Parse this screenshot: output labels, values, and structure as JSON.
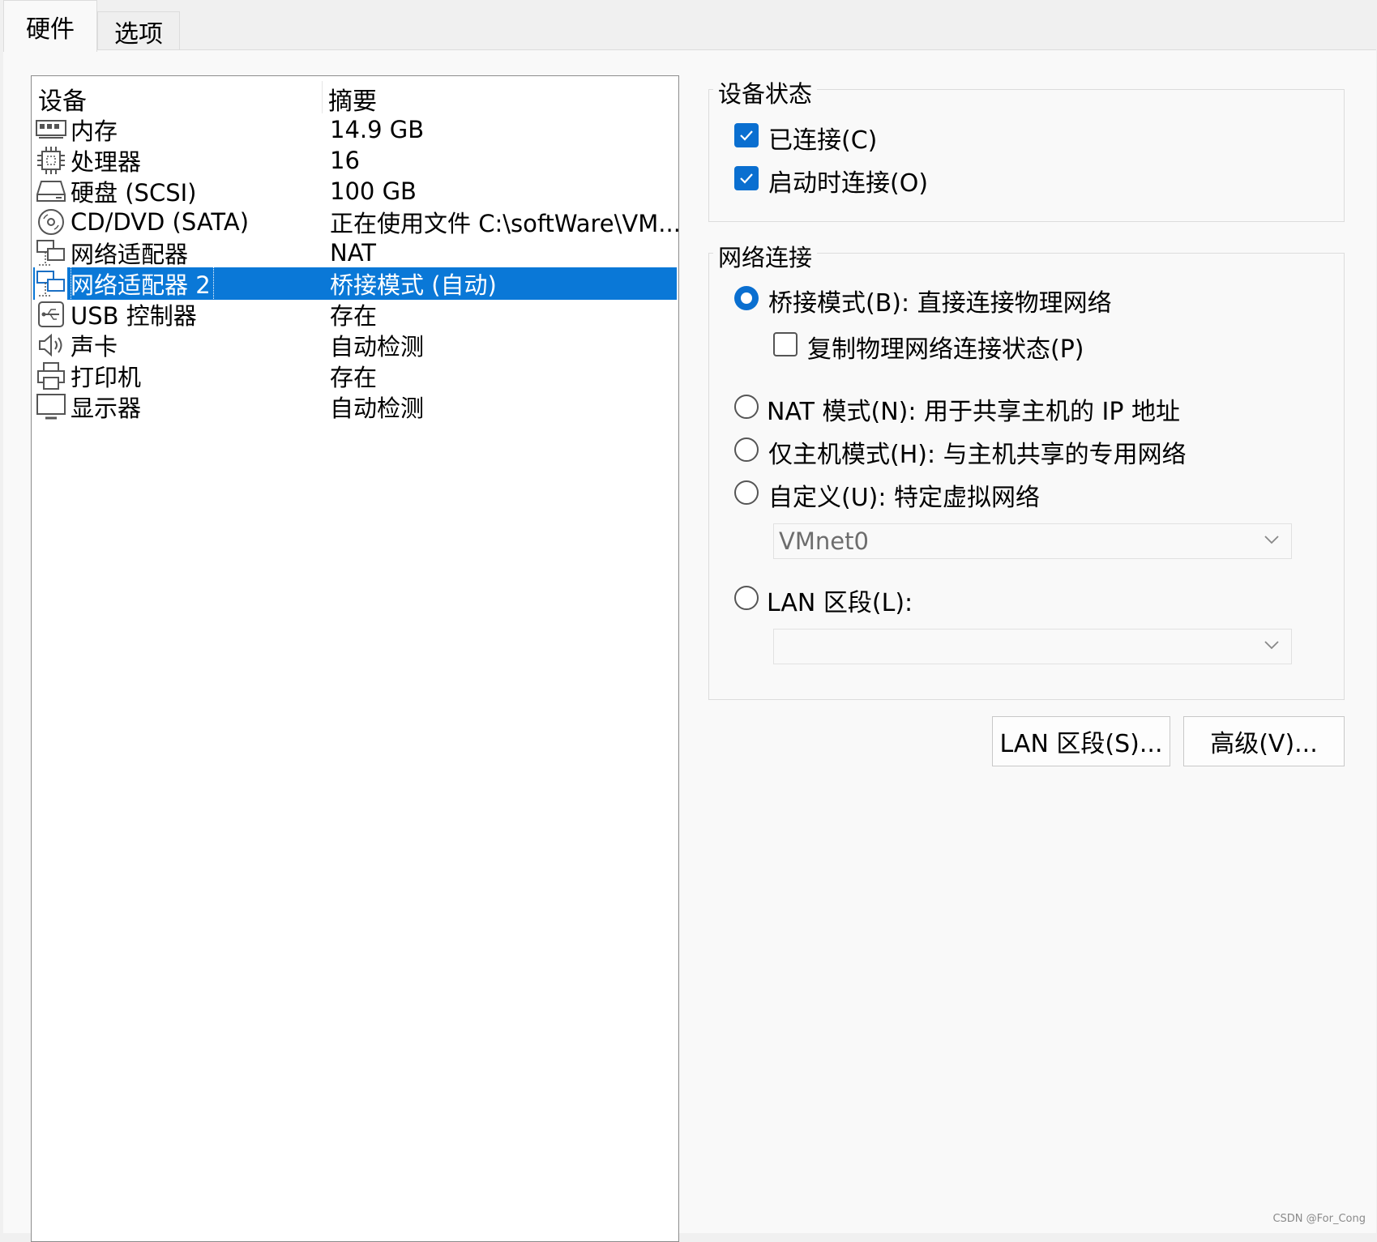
{
  "tabs": [
    {
      "label": "硬件",
      "active": true
    },
    {
      "label": "选项",
      "active": false
    }
  ],
  "device_list": {
    "columns": [
      "设备",
      "摘要"
    ],
    "rows": [
      {
        "icon": "memory-icon",
        "name": "内存",
        "summary": "14.9 GB"
      },
      {
        "icon": "cpu-icon",
        "name": "处理器",
        "summary": "16"
      },
      {
        "icon": "harddisk-icon",
        "name": "硬盘 (SCSI)",
        "summary": "100 GB"
      },
      {
        "icon": "cd-dvd-icon",
        "name": "CD/DVD (SATA)",
        "summary": "正在使用文件 C:\\softWare\\VM..."
      },
      {
        "icon": "network-adapter-icon",
        "name": "网络适配器",
        "summary": "NAT"
      },
      {
        "icon": "network-adapter-icon",
        "name": "网络适配器 2",
        "summary": "桥接模式 (自动)",
        "selected": true
      },
      {
        "icon": "usb-icon",
        "name": "USB 控制器",
        "summary": "存在"
      },
      {
        "icon": "speaker-icon",
        "name": "声卡",
        "summary": "自动检测"
      },
      {
        "icon": "printer-icon",
        "name": "打印机",
        "summary": "存在"
      },
      {
        "icon": "monitor-icon",
        "name": "显示器",
        "summary": "自动检测"
      }
    ]
  },
  "device_status": {
    "title": "设备状态",
    "connected": {
      "label": "已连接(C)",
      "checked": true
    },
    "connect_at_power_on": {
      "label": "启动时连接(O)",
      "checked": true
    }
  },
  "network_connection": {
    "title": "网络连接",
    "bridged": {
      "label": "桥接模式(B): 直接连接物理网络",
      "selected": true
    },
    "replicate_state": {
      "label": "复制物理网络连接状态(P)",
      "checked": false
    },
    "nat": {
      "label": "NAT 模式(N): 用于共享主机的 IP 地址",
      "selected": false
    },
    "host_only": {
      "label": "仅主机模式(H): 与主机共享的专用网络",
      "selected": false
    },
    "custom": {
      "label": "自定义(U): 特定虚拟网络",
      "selected": false
    },
    "custom_network_value": "VMnet0",
    "lan_segment": {
      "label": "LAN 区段(L):",
      "selected": false
    },
    "lan_segment_value": ""
  },
  "buttons": {
    "lan_segments": "LAN 区段(S)...",
    "advanced": "高级(V)..."
  },
  "watermark": "CSDN @For_Cong",
  "colors": {
    "accent": "#0a6fd0",
    "selection": "#0a78d7"
  }
}
